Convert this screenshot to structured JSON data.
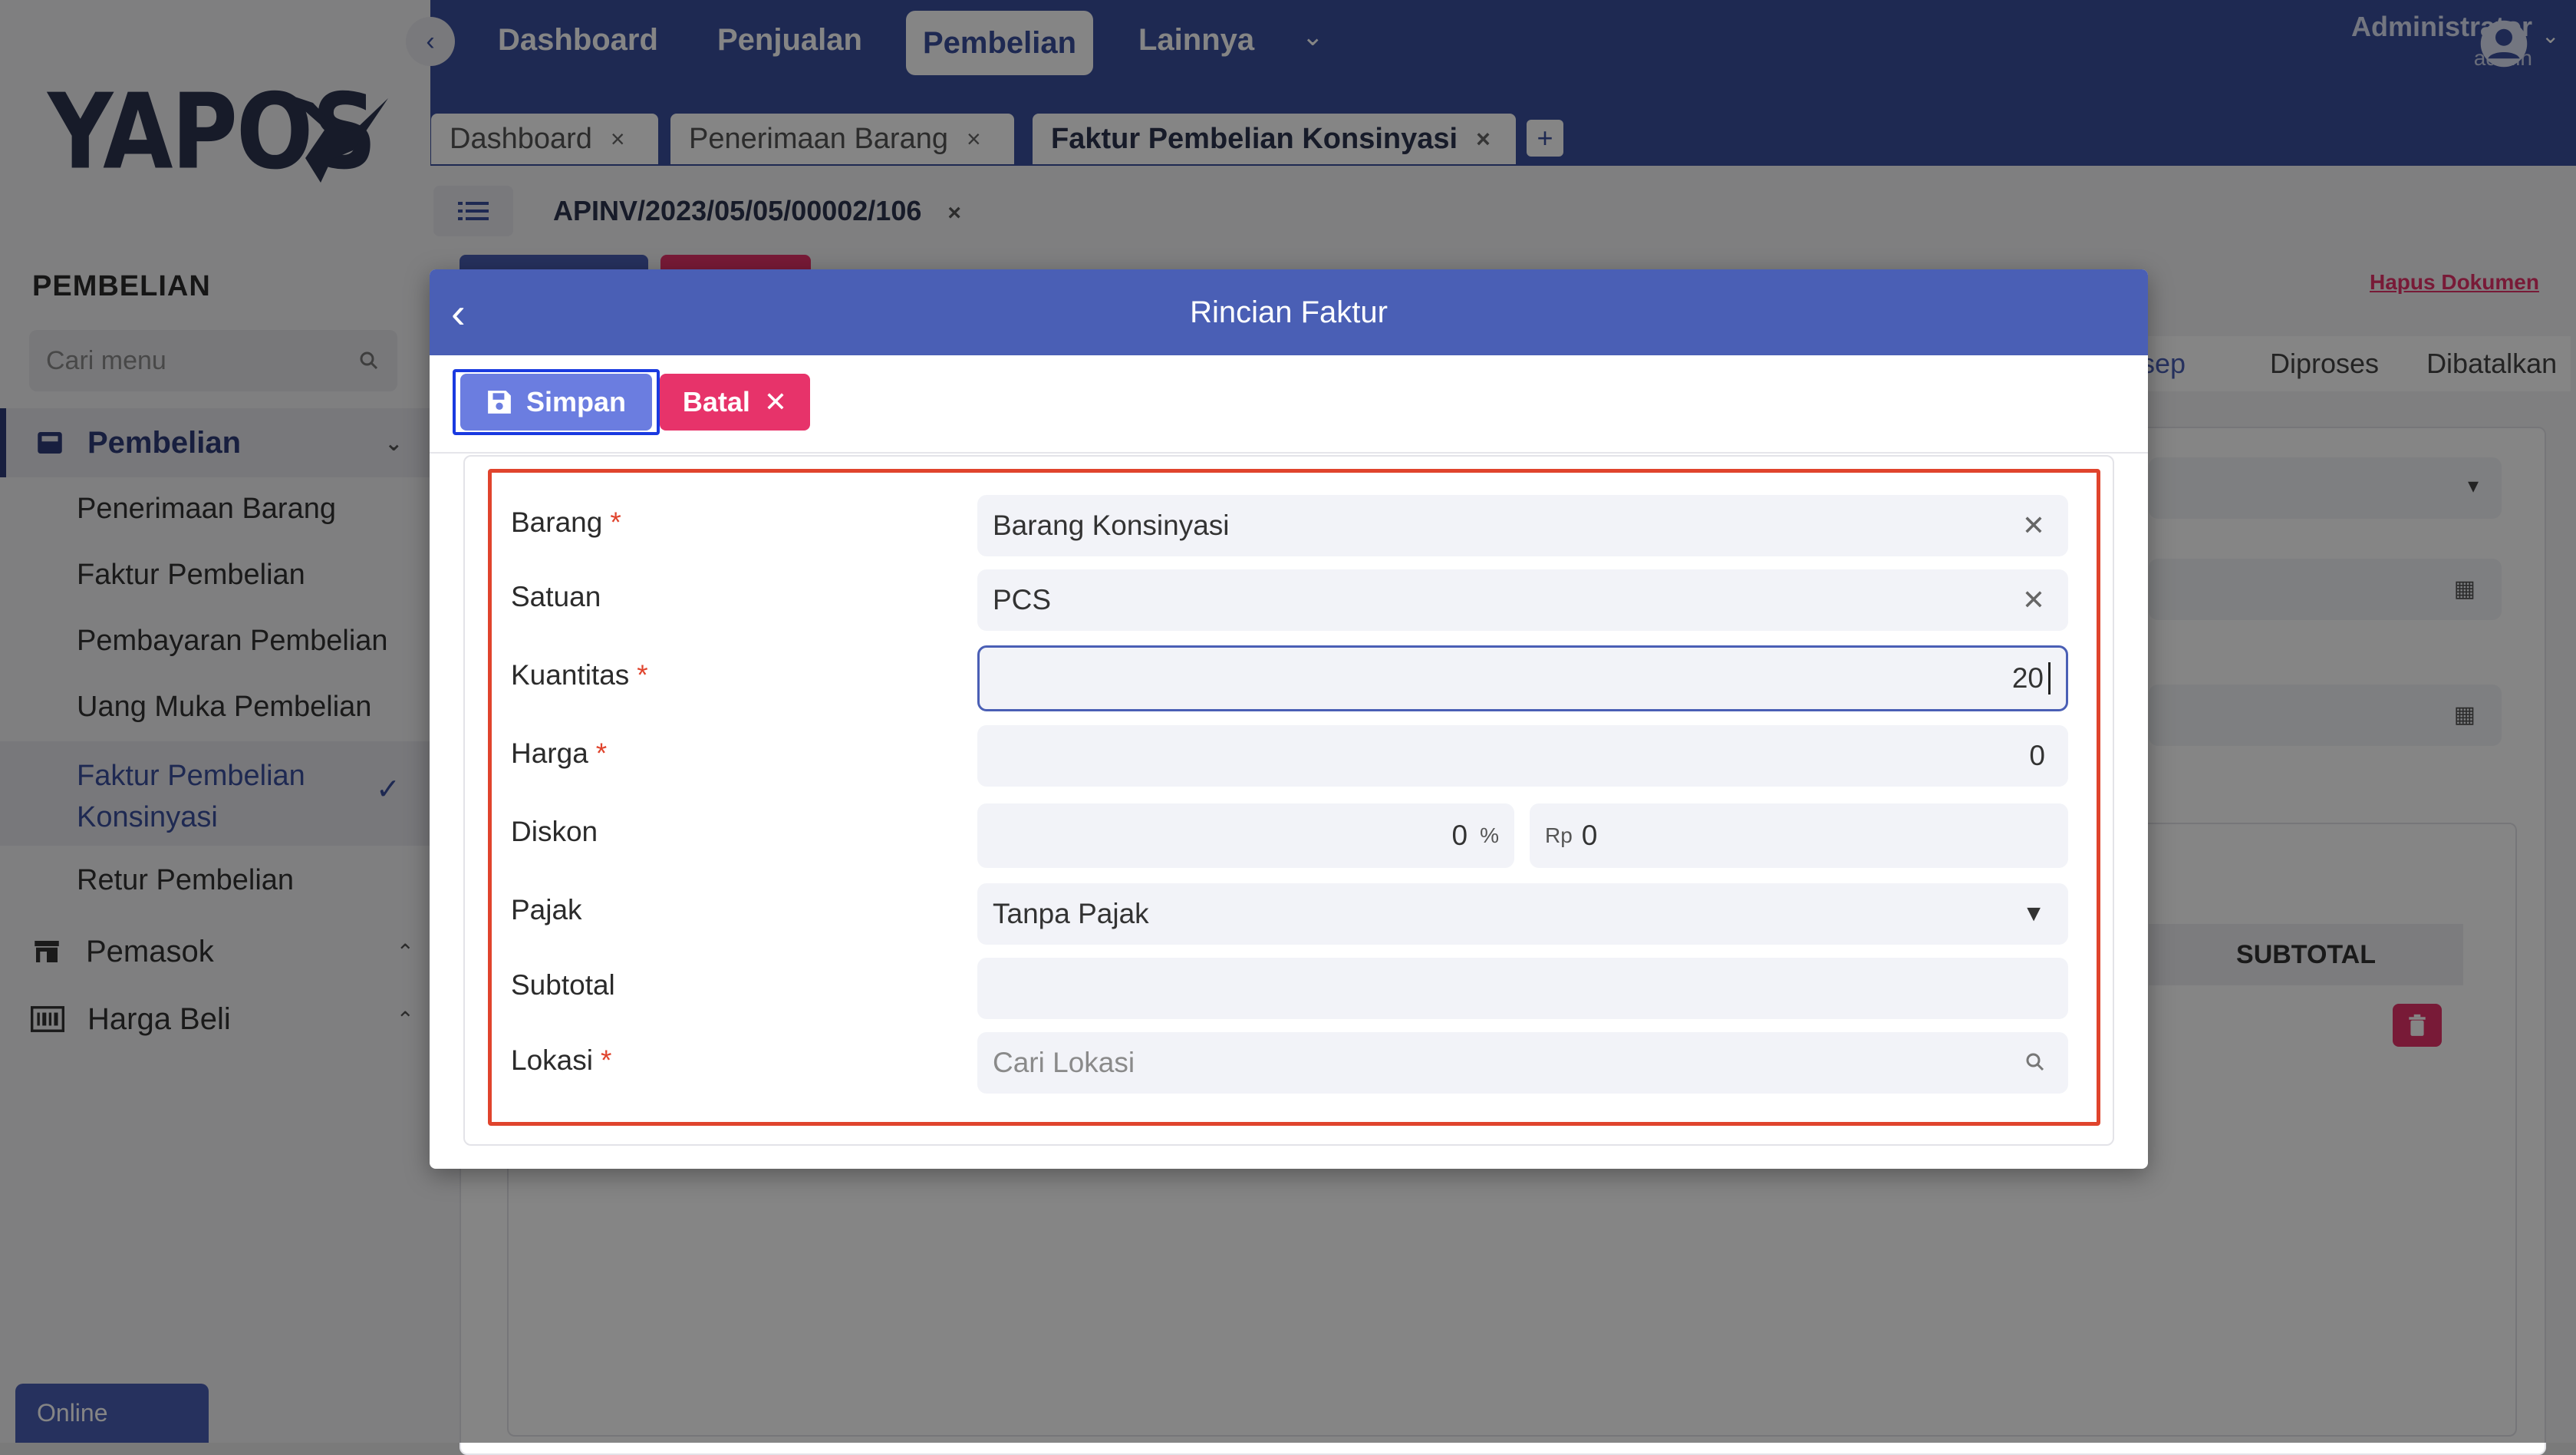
{
  "app": {
    "logo": "YAPOS"
  },
  "topnav": {
    "items": [
      "Dashboard",
      "Penjualan",
      "Pembelian",
      "Lainnya"
    ],
    "user_name": "Administrator",
    "user_role": "admin"
  },
  "tabs": {
    "items": [
      "Dashboard",
      "Penerimaan Barang",
      "Faktur Pembelian Konsinyasi"
    ],
    "add_label": "+"
  },
  "doc_tab": {
    "label": "APINV/2023/05/05/00002/106"
  },
  "sidebar": {
    "section": "PEMBELIAN",
    "search_placeholder": "Cari menu",
    "group_active": "Pembelian",
    "items": [
      "Penerimaan Barang",
      "Faktur Pembelian",
      "Pembayaran Pembelian",
      "Uang Muka Pembelian",
      "Faktur Pembelian Konsinyasi",
      "Retur Pembelian"
    ],
    "group_supplier": "Pemasok",
    "group_price": "Harga Beli"
  },
  "status": {
    "online": "Online"
  },
  "background": {
    "hapus_dokumen": "Hapus Dokumen",
    "steps": [
      "sep",
      "Diproses",
      "Dibatalkan"
    ],
    "subtotal_header": "SUBTOTAL"
  },
  "modal": {
    "title": "Rincian Faktur",
    "save_label": "Simpan",
    "cancel_label": "Batal",
    "fields": {
      "barang": {
        "label": "Barang",
        "value": "Barang Konsinyasi"
      },
      "satuan": {
        "label": "Satuan",
        "value": "PCS"
      },
      "kuantitas": {
        "label": "Kuantitas",
        "value": "20"
      },
      "harga": {
        "label": "Harga",
        "value": "0"
      },
      "diskon": {
        "label": "Diskon",
        "percent_value": "0",
        "percent_unit": "%",
        "rp_prefix": "Rp",
        "rp_value": "0"
      },
      "pajak": {
        "label": "Pajak",
        "value": "Tanpa Pajak"
      },
      "subtotal": {
        "label": "Subtotal",
        "value": ""
      },
      "lokasi": {
        "label": "Lokasi",
        "placeholder": "Cari Lokasi"
      }
    }
  },
  "colors": {
    "primary": "#4a5fb5",
    "danger": "#e7336a",
    "required": "#e0442d",
    "nav": "#3b4f9e"
  }
}
